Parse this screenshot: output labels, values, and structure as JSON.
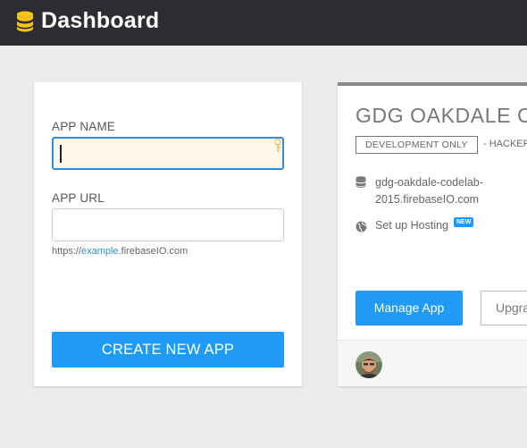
{
  "header": {
    "title": "Dashboard",
    "logo_icon": "database-icon",
    "background": "#2b2d31"
  },
  "new_app_form": {
    "name_label": "APP NAME",
    "name_value": "",
    "url_label": "APP URL",
    "url_value": "",
    "hint_prefix": "https://",
    "hint_highlight": "example",
    "hint_suffix": ".firebaseIO.com",
    "create_button": "CREATE NEW APP"
  },
  "app_card": {
    "title": "GDG OAKDALE CODELAB",
    "status_badge": "DEVELOPMENT ONLY",
    "plan": "- HACKER PLAN",
    "database_url_line1": "gdg-oakdale-codelab-",
    "database_url_line2": "2015.firebaseIO.com",
    "hosting_label": "Set up Hosting",
    "new_badge": "NEW",
    "manage_button": "Manage App",
    "upgrade_button": "Upgrade"
  },
  "colors": {
    "accent": "#1f9af5",
    "focus_border": "#3a8ad9",
    "topbar": "#2b2d31",
    "logo": "#f5c31c"
  }
}
